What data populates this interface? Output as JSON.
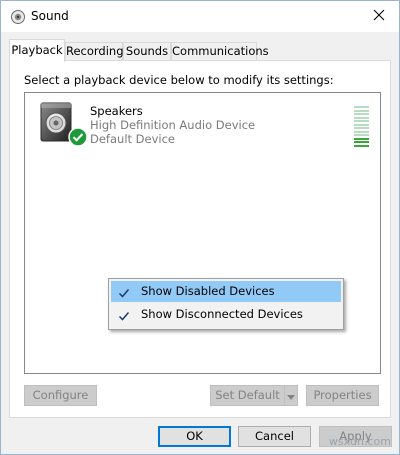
{
  "window": {
    "title": "Sound",
    "icon": "speaker-icon",
    "close_icon": "close-icon"
  },
  "tabs": [
    {
      "label": "Playback",
      "active": true
    },
    {
      "label": "Recording",
      "active": false
    },
    {
      "label": "Sounds",
      "active": false
    },
    {
      "label": "Communications",
      "active": false
    }
  ],
  "panel": {
    "instruction": "Select a playback device below to modify its settings:"
  },
  "devices": [
    {
      "name": "Speakers",
      "description": "High Definition Audio Device",
      "status": "Default Device",
      "icon": "speakers-icon",
      "badge": "default-check-icon",
      "level_bars_active": 3,
      "level_bars_total": 12
    }
  ],
  "context_menu": {
    "items": [
      {
        "label": "Show Disabled Devices",
        "checked": true,
        "highlighted": true
      },
      {
        "label": "Show Disconnected Devices",
        "checked": true,
        "highlighted": false
      }
    ]
  },
  "buttons": {
    "configure": "Configure",
    "set_default": "Set Default",
    "properties": "Properties",
    "ok": "OK",
    "cancel": "Cancel",
    "apply": "Apply"
  },
  "watermark": "wsxdn.com",
  "colors": {
    "accent": "#0078d7",
    "menu_highlight": "#91c9f7",
    "meter_active": "#3aa53a",
    "meter_inactive": "#b8dcc0",
    "check_badge": "#1e9a3c"
  }
}
